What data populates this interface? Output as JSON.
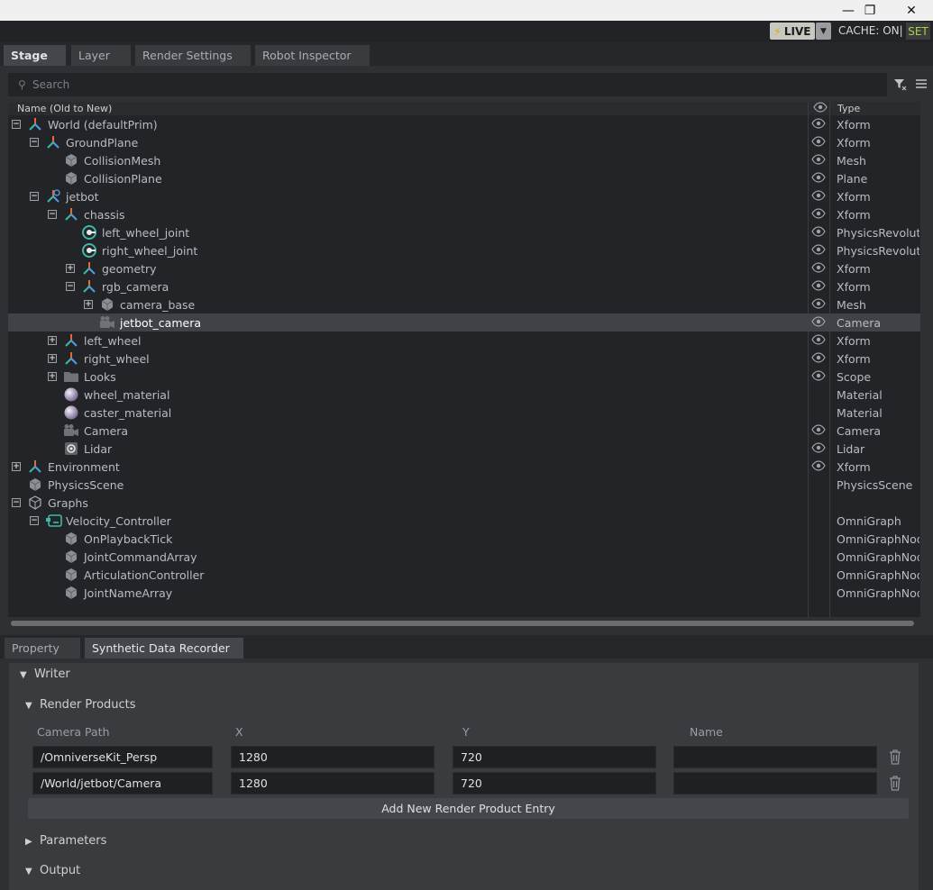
{
  "window": {
    "minimize": "—",
    "restore": "❐",
    "close": "✕"
  },
  "appbar": {
    "live_label": "LIVE",
    "cache_label": "CACHE: ON|",
    "set_label": "SET"
  },
  "top_tabs": [
    "Stage",
    "Layer",
    "Render Settings",
    "Robot Inspector"
  ],
  "search": {
    "placeholder": "Search"
  },
  "tree": {
    "col_name": "Name (Old to New)",
    "col_type": "Type",
    "rows": [
      {
        "name": "World (defaultPrim)",
        "type": "Xform",
        "icon": "xform-icon"
      },
      {
        "name": "GroundPlane",
        "type": "Xform",
        "icon": "xform-icon"
      },
      {
        "name": "CollisionMesh",
        "type": "Mesh",
        "icon": "mesh-cube-icon"
      },
      {
        "name": "CollisionPlane",
        "type": "Plane",
        "icon": "mesh-cube-icon"
      },
      {
        "name": "jetbot",
        "type": "Xform",
        "icon": "robot-xform-icon"
      },
      {
        "name": "chassis",
        "type": "Xform",
        "icon": "xform-icon"
      },
      {
        "name": "left_wheel_joint",
        "type": "PhysicsRevoluteJoint",
        "icon": "joint-icon"
      },
      {
        "name": "right_wheel_joint",
        "type": "PhysicsRevoluteJoint",
        "icon": "joint-icon"
      },
      {
        "name": "geometry",
        "type": "Xform",
        "icon": "xform-icon"
      },
      {
        "name": "rgb_camera",
        "type": "Xform",
        "icon": "xform-icon"
      },
      {
        "name": "camera_base",
        "type": "Mesh",
        "icon": "mesh-cube-icon"
      },
      {
        "name": "jetbot_camera",
        "type": "Camera",
        "icon": "camera-icon"
      },
      {
        "name": "left_wheel",
        "type": "Xform",
        "icon": "xform-icon"
      },
      {
        "name": "right_wheel",
        "type": "Xform",
        "icon": "xform-icon"
      },
      {
        "name": "Looks",
        "type": "Scope",
        "icon": "folder-icon"
      },
      {
        "name": "wheel_material",
        "type": "Material",
        "icon": "material-sphere-icon"
      },
      {
        "name": "caster_material",
        "type": "Material",
        "icon": "material-sphere-icon"
      },
      {
        "name": "Camera",
        "type": "Camera",
        "icon": "camera-icon"
      },
      {
        "name": "Lidar",
        "type": "Lidar",
        "icon": "lidar-icon"
      },
      {
        "name": "Environment",
        "type": "Xform",
        "icon": "xform-icon"
      },
      {
        "name": "PhysicsScene",
        "type": "PhysicsScene",
        "icon": "mesh-cube-icon"
      },
      {
        "name": "Graphs",
        "type": "",
        "icon": "graph-cube-icon"
      },
      {
        "name": "Velocity_Controller",
        "type": "OmniGraph",
        "icon": "omnigraph-icon"
      },
      {
        "name": "OnPlaybackTick",
        "type": "OmniGraphNode",
        "icon": "mesh-cube-icon"
      },
      {
        "name": "JointCommandArray",
        "type": "OmniGraphNode",
        "icon": "mesh-cube-icon"
      },
      {
        "name": "ArticulationController",
        "type": "OmniGraphNode",
        "icon": "mesh-cube-icon"
      },
      {
        "name": "JointNameArray",
        "type": "OmniGraphNode",
        "icon": "mesh-cube-icon"
      }
    ]
  },
  "bottom_tabs": [
    "Property",
    "Synthetic Data Recorder"
  ],
  "recorder": {
    "writer": "Writer",
    "render_products": "Render Products",
    "headers": {
      "camera_path": "Camera Path",
      "x": "X",
      "y": "Y",
      "name": "Name"
    },
    "entries": [
      {
        "camera_path": "/OmniverseKit_Persp",
        "x": "1280",
        "y": "720",
        "name": ""
      },
      {
        "camera_path": "/World/jetbot/Camera",
        "x": "1280",
        "y": "720",
        "name": ""
      }
    ],
    "add_label": "Add New Render Product Entry",
    "parameters": "Parameters",
    "output": "Output"
  },
  "colors": {
    "accent_teal": "#3fb7a8",
    "accent_orange": "#e0703a",
    "selected_row": "#3f4247",
    "live_bg": "#c8c8c0",
    "set_green": "#a7d34a"
  }
}
